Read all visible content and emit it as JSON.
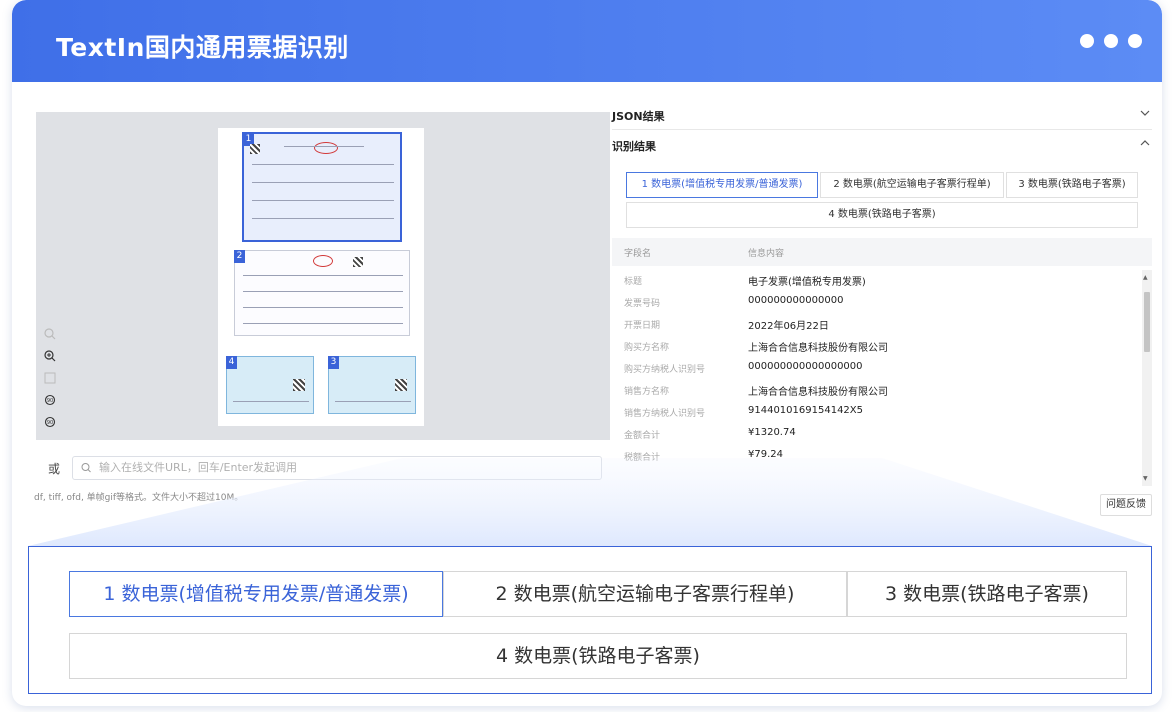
{
  "header": {
    "title": "TextIn国内通用票据识别"
  },
  "preview": {
    "upload_or": "或",
    "url_placeholder": "输入在线文件URL，回车/Enter发起调用",
    "format_hint": "df, tiff, ofd, 单帧gif等格式。文件大小不超过10M。",
    "doc_tags": [
      "1",
      "2",
      "3",
      "4"
    ],
    "tools": [
      "zoom-out-icon",
      "zoom-in-icon",
      "fit-icon",
      "rotate-left-icon",
      "rotate-right-icon"
    ]
  },
  "right": {
    "json_label": "JSON结果",
    "result_label": "识别结果",
    "tabs": [
      "1 数电票(增值税专用发票/普通发票)",
      "2 数电票(航空运输电子客票行程单)",
      "3 数电票(铁路电子客票)",
      "4 数电票(铁路电子客票)"
    ],
    "field_header": {
      "name": "字段名",
      "content": "信息内容"
    },
    "fields": [
      {
        "k": "标题",
        "v": "电子发票(增值税专用发票)"
      },
      {
        "k": "发票号码",
        "v": "000000000000000"
      },
      {
        "k": "开票日期",
        "v": "2022年06月22日"
      },
      {
        "k": "购买方名称",
        "v": "上海合合信息科技股份有限公司"
      },
      {
        "k": "购买方纳税人识别号",
        "v": "000000000000000000"
      },
      {
        "k": "销售方名称",
        "v": "上海合合信息科技股份有限公司"
      },
      {
        "k": "销售方纳税人识别号",
        "v": "9144010169154142X5"
      },
      {
        "k": "金额合计",
        "v": "¥1320.74"
      },
      {
        "k": "税额合计",
        "v": "¥79.24"
      }
    ],
    "feedback_label": "问题反馈"
  },
  "zoom": {
    "tabs": [
      "1 数电票(增值税专用发票/普通发票)",
      "2 数电票(航空运输电子客票行程单)",
      "3 数电票(铁路电子客票)",
      "4 数电票(铁路电子客票)"
    ]
  },
  "colors": {
    "accent": "#3a63d8",
    "header_start": "#3f6fe8",
    "header_end": "#5c8cf5"
  }
}
